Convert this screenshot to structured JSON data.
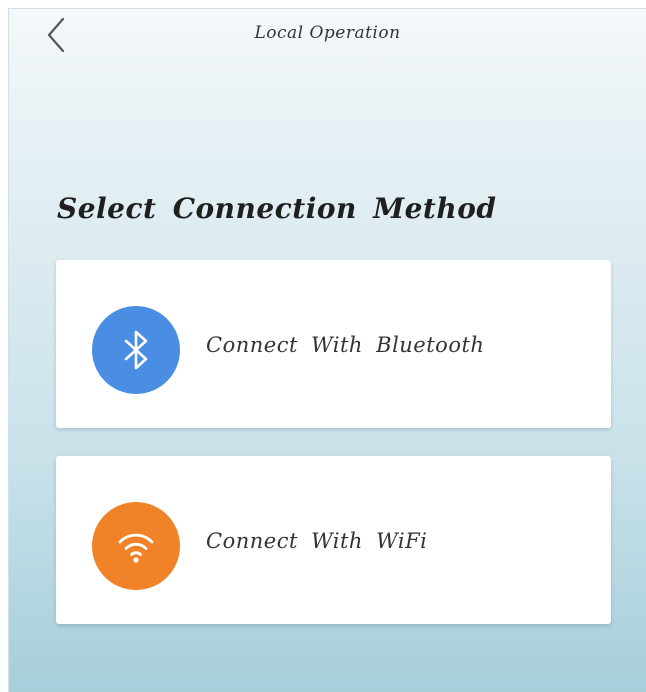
{
  "header": {
    "title": "Local Operation",
    "back_icon": "chevron-left-icon"
  },
  "main": {
    "heading": "Select Connection Method",
    "options": [
      {
        "label": "Connect With Bluetooth",
        "icon": "bluetooth-icon",
        "color": "#4a8ee3"
      },
      {
        "label": "Connect With WiFi",
        "icon": "wifi-icon",
        "color": "#f08228"
      }
    ]
  }
}
